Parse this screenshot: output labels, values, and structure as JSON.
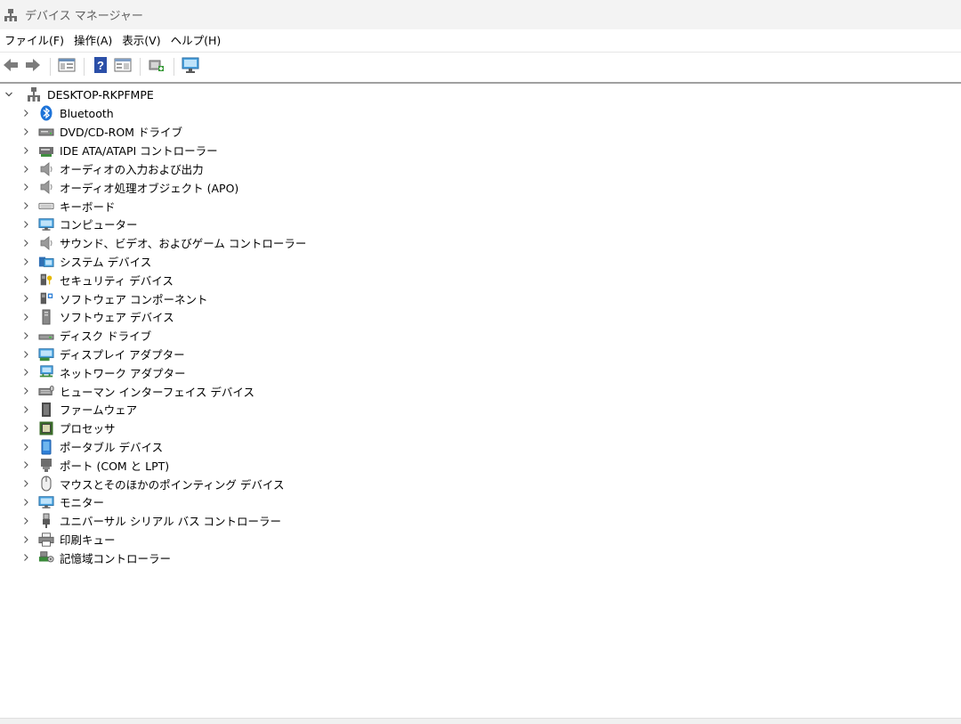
{
  "window": {
    "title": "デバイス マネージャー"
  },
  "menu": [
    {
      "label": "ファイル(F)"
    },
    {
      "label": "操作(A)"
    },
    {
      "label": "表示(V)"
    },
    {
      "label": "ヘルプ(H)"
    }
  ],
  "toolbar": {
    "buttons": [
      "back-icon",
      "forward-icon",
      "properties-icon",
      "help-icon",
      "view-icon",
      "update-driver-icon",
      "monitor-icon"
    ]
  },
  "tree": {
    "root": {
      "label": "DESKTOP-RKPFMPE",
      "icon": "computer-tree-icon",
      "expanded": true
    },
    "items": [
      {
        "label": "Bluetooth",
        "icon": "bluetooth-icon"
      },
      {
        "label": "DVD/CD-ROM ドライブ",
        "icon": "dvd-drive-icon"
      },
      {
        "label": "IDE ATA/ATAPI コントローラー",
        "icon": "ide-controller-icon"
      },
      {
        "label": "オーディオの入力および出力",
        "icon": "speaker-icon"
      },
      {
        "label": "オーディオ処理オブジェクト (APO)",
        "icon": "speaker-icon"
      },
      {
        "label": "キーボード",
        "icon": "keyboard-icon"
      },
      {
        "label": "コンピューター",
        "icon": "computer-icon"
      },
      {
        "label": "サウンド、ビデオ、およびゲーム コントローラー",
        "icon": "speaker-icon"
      },
      {
        "label": "システム デバイス",
        "icon": "system-device-icon"
      },
      {
        "label": "セキュリティ デバイス",
        "icon": "security-device-icon"
      },
      {
        "label": "ソフトウェア コンポーネント",
        "icon": "software-component-icon"
      },
      {
        "label": "ソフトウェア デバイス",
        "icon": "software-device-icon"
      },
      {
        "label": "ディスク ドライブ",
        "icon": "disk-drive-icon"
      },
      {
        "label": "ディスプレイ アダプター",
        "icon": "display-adapter-icon"
      },
      {
        "label": "ネットワーク アダプター",
        "icon": "network-adapter-icon"
      },
      {
        "label": "ヒューマン インターフェイス デバイス",
        "icon": "hid-icon"
      },
      {
        "label": "ファームウェア",
        "icon": "firmware-icon"
      },
      {
        "label": "プロセッサ",
        "icon": "processor-icon"
      },
      {
        "label": "ポータブル デバイス",
        "icon": "portable-device-icon"
      },
      {
        "label": "ポート (COM と LPT)",
        "icon": "port-icon"
      },
      {
        "label": "マウスとそのほかのポインティング デバイス",
        "icon": "mouse-icon"
      },
      {
        "label": "モニター",
        "icon": "monitor-icon"
      },
      {
        "label": "ユニバーサル シリアル バス コントローラー",
        "icon": "usb-icon"
      },
      {
        "label": "印刷キュー",
        "icon": "printer-icon"
      },
      {
        "label": "記憶域コントローラー",
        "icon": "storage-controller-icon"
      }
    ]
  }
}
